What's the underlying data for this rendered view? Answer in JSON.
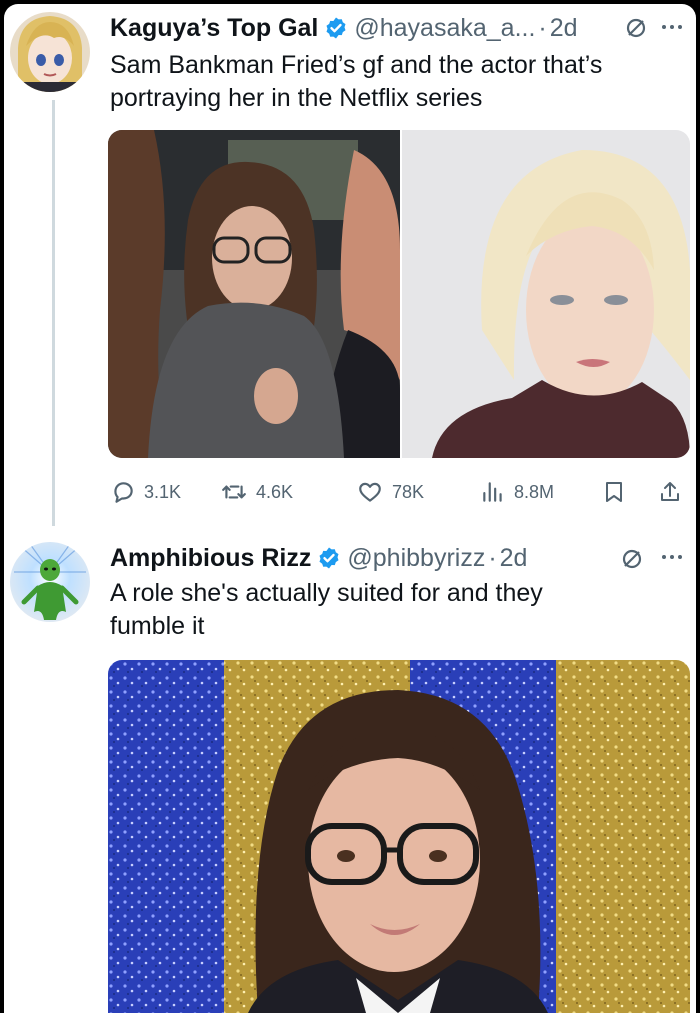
{
  "tweet1": {
    "display_name": "Kaguya’s Top Gal",
    "handle": "@hayasaka_a...",
    "separator": "·",
    "time": "2d",
    "text_line1": "Sam Bankman Fried’s gf and the actor that’s",
    "text_line2": "portraying her in the Netflix series",
    "stats": {
      "replies": "3.1K",
      "reposts": "4.6K",
      "likes": "78K",
      "views": "8.8M"
    }
  },
  "tweet2": {
    "display_name": "Amphibious Rizz",
    "handle": "@phibbyrizz",
    "separator": "·",
    "time": "2d",
    "text_line1": "A role she's actually suited for and they",
    "text_line2": "fumble it"
  },
  "colors": {
    "text_primary": "#0f1419",
    "text_secondary": "#536471",
    "verified_blue": "#1d9bf0",
    "thread_line": "#cfd9de"
  },
  "icons": [
    "verified-badge-icon",
    "grok-icon",
    "more-icon",
    "reply-icon",
    "repost-icon",
    "like-icon",
    "views-icon",
    "bookmark-icon",
    "share-icon"
  ]
}
